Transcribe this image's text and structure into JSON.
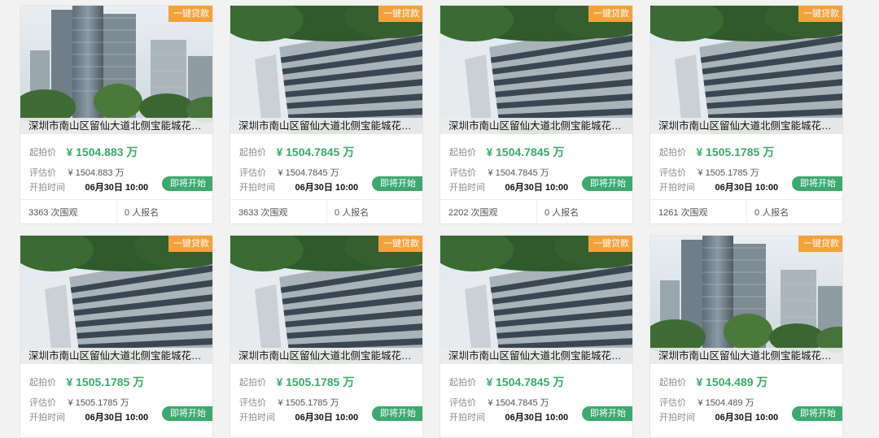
{
  "labels": {
    "start_price": "起拍价",
    "appraise": "评估价",
    "start_time": "开拍时间",
    "badge": "一键贷款",
    "status": "即将开始",
    "views_suffix": "次围观",
    "signups_suffix": "人报名"
  },
  "listings": [
    {
      "photo": "tower",
      "title": "深圳市南山区留仙大道北侧宝能城花园...",
      "price": "¥ 1504.883 万",
      "appraise": "¥ 1504.883 万",
      "time": "06月30日 10:00",
      "views": "3363",
      "signups": "0"
    },
    {
      "photo": "building",
      "title": "深圳市南山区留仙大道北侧宝能城花园...",
      "price": "¥ 1504.7845 万",
      "appraise": "¥ 1504.7845 万",
      "time": "06月30日 10:00",
      "views": "3633",
      "signups": "0"
    },
    {
      "photo": "building",
      "title": "深圳市南山区留仙大道北侧宝能城花园...",
      "price": "¥ 1504.7845 万",
      "appraise": "¥ 1504.7845 万",
      "time": "06月30日 10:00",
      "views": "2202",
      "signups": "0"
    },
    {
      "photo": "building",
      "title": "深圳市南山区留仙大道北侧宝能城花园...",
      "price": "¥ 1505.1785 万",
      "appraise": "¥ 1505.1785 万",
      "time": "06月30日 10:00",
      "views": "1261",
      "signups": "0"
    },
    {
      "photo": "building",
      "title": "深圳市南山区留仙大道北侧宝能城花园...",
      "price": "¥ 1505.1785 万",
      "appraise": "¥ 1505.1785 万",
      "time": "06月30日 10:00"
    },
    {
      "photo": "building",
      "title": "深圳市南山区留仙大道北侧宝能城花园...",
      "price": "¥ 1505.1785 万",
      "appraise": "¥ 1505.1785 万",
      "time": "06月30日 10:00"
    },
    {
      "photo": "building",
      "title": "深圳市南山区留仙大道北侧宝能城花园...",
      "price": "¥ 1504.7845 万",
      "appraise": "¥ 1504.7845 万",
      "time": "06月30日 10:00"
    },
    {
      "photo": "tower",
      "title": "深圳市南山区留仙大道北侧宝能城花园...",
      "price": "¥ 1504.489 万",
      "appraise": "¥ 1504.489 万",
      "time": "06月30日 10:00"
    }
  ],
  "colors": {
    "accent_green": "#3aaa6e",
    "badge_orange": "#f5a139",
    "background": "#f2f2f2"
  }
}
